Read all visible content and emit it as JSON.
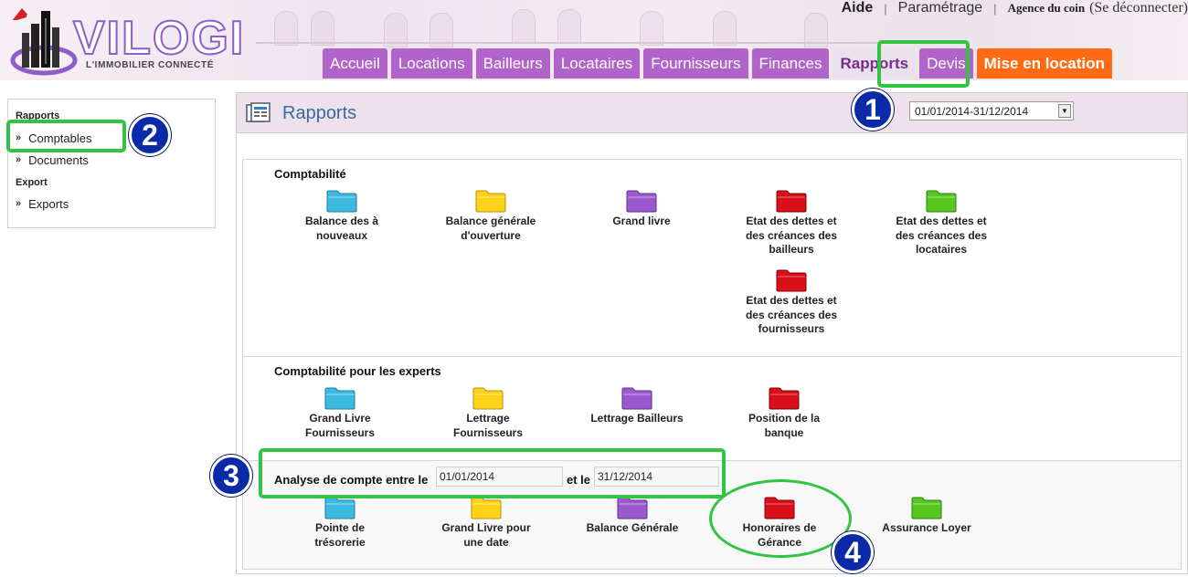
{
  "logo": {
    "name": "VILOGI",
    "tagline": "L'IMMOBILIER CONNECTÉ"
  },
  "top_links": {
    "help": "Aide",
    "separator": "|",
    "settings": "Paramétrage",
    "agency": "Agence du coin",
    "logout": "(Se déconnecter)"
  },
  "nav": {
    "tabs": [
      "Accueil",
      "Locations",
      "Bailleurs",
      "Locataires",
      "Fournisseurs",
      "Finances",
      "Rapports",
      "Devis",
      "Mise en location"
    ],
    "active": "Rapports",
    "cta": "Mise en location"
  },
  "sidebar": {
    "rapports_heading": "Rapports",
    "comptables": "Comptables",
    "documents": "Documents",
    "export_heading": "Export",
    "exports": "Exports",
    "bullet": "»"
  },
  "panel": {
    "title": "Rapports",
    "period": "01/01/2014-31/12/2014"
  },
  "sections": {
    "comptabilite": {
      "title": "Comptabilité",
      "reports": [
        {
          "lines": [
            "Balance des à",
            "nouveaux"
          ],
          "color": "#3db9e0"
        },
        {
          "lines": [
            "Balance générale",
            "d'ouverture"
          ],
          "color": "#ffd21a"
        },
        {
          "lines": [
            "Grand livre"
          ],
          "color": "#9b59d0"
        },
        {
          "lines": [
            "Etat des dettes et",
            "des créances des",
            "bailleurs"
          ],
          "color": "#d9101a"
        },
        {
          "lines": [
            "Etat des dettes et",
            "des créances des",
            "locataires"
          ],
          "color": "#55c71e"
        },
        {
          "lines": [
            "Etat des dettes et",
            "des créances des",
            "fournisseurs"
          ],
          "color": "#d9101a"
        }
      ]
    },
    "experts": {
      "title": "Comptabilité pour les experts",
      "reports": [
        {
          "lines": [
            "Grand Livre",
            "Fournisseurs"
          ],
          "color": "#3db9e0"
        },
        {
          "lines": [
            "Lettrage",
            "Fournisseurs"
          ],
          "color": "#ffd21a"
        },
        {
          "lines": [
            "Lettrage Bailleurs"
          ],
          "color": "#9b59d0"
        },
        {
          "lines": [
            "Position de la",
            "banque"
          ],
          "color": "#d9101a"
        }
      ]
    },
    "analyse": {
      "label_from": "Analyse de compte entre le",
      "date_from": "01/01/2014",
      "label_to": "et le",
      "date_to": "31/12/2014",
      "reports": [
        {
          "lines": [
            "Pointe de",
            "trésorerie"
          ],
          "color": "#3db9e0"
        },
        {
          "lines": [
            "Grand Livre pour",
            "une date"
          ],
          "color": "#ffd21a"
        },
        {
          "lines": [
            "Balance Générale"
          ],
          "color": "#9b59d0"
        },
        {
          "lines": [
            "Honoraires de",
            "Gérance"
          ],
          "color": "#d9101a"
        },
        {
          "lines": [
            "Assurance Loyer"
          ],
          "color": "#55c71e"
        }
      ]
    }
  },
  "annotations": [
    "1",
    "2",
    "3",
    "4"
  ],
  "colors": {
    "nav_tab": "#b063c8",
    "nav_cta": "#ff6a13",
    "highlight": "#2fc441",
    "badge": "#0b2aa8",
    "title_blue": "#3a6a9a"
  }
}
